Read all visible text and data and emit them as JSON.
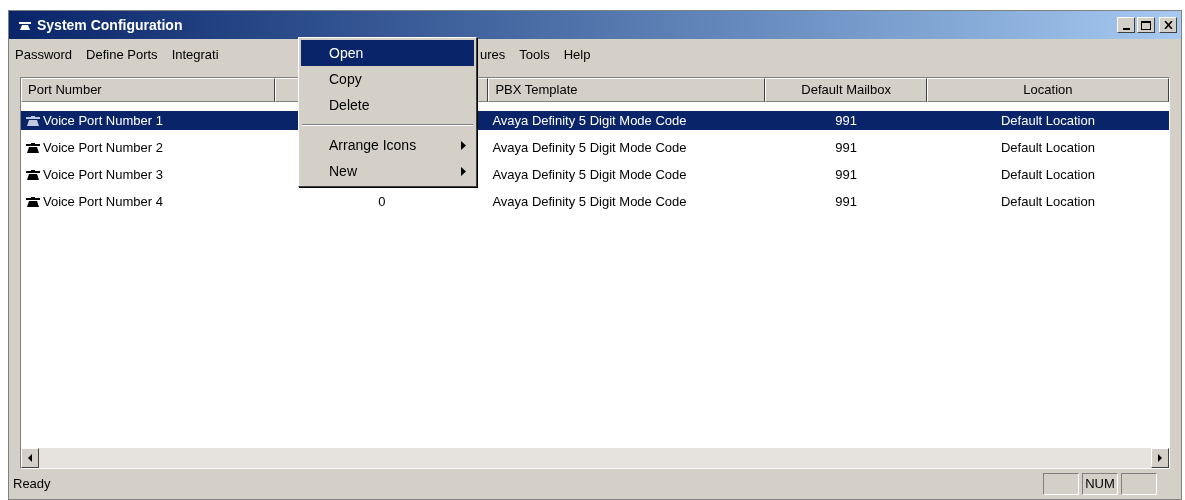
{
  "window": {
    "title": "System Configuration"
  },
  "menu_bar": [
    "Password",
    "Define Ports",
    "Integrati",
    "ures",
    "Tools",
    "Help"
  ],
  "table": {
    "columns": [
      "Port Number",
      "",
      "PBX Template",
      "Default Mailbox",
      "Location"
    ],
    "rows": [
      {
        "selected": true,
        "cells": [
          "Voice Port Number 1",
          "",
          "Avaya Definity 5 Digit Mode Code",
          "991",
          "Default Location"
        ]
      },
      {
        "selected": false,
        "cells": [
          "Voice Port Number 2",
          "",
          "Avaya Definity 5 Digit Mode Code",
          "991",
          "Default Location"
        ]
      },
      {
        "selected": false,
        "cells": [
          "Voice Port Number 3",
          "",
          "Avaya Definity 5 Digit Mode Code",
          "991",
          "Default Location"
        ]
      },
      {
        "selected": false,
        "cells": [
          "Voice Port Number 4",
          "0",
          "Avaya Definity 5 Digit Mode Code",
          "991",
          "Default Location"
        ]
      }
    ]
  },
  "context_menu": [
    {
      "kind": "item",
      "label": "Open",
      "selected": true
    },
    {
      "kind": "item",
      "label": "Copy",
      "selected": false
    },
    {
      "kind": "item",
      "label": "Delete",
      "selected": false
    },
    {
      "kind": "separator"
    },
    {
      "kind": "submenu",
      "label": "Arrange Icons",
      "selected": false
    },
    {
      "kind": "submenu",
      "label": "New",
      "selected": false
    }
  ],
  "status_bar": {
    "text": "Ready",
    "panels": [
      "NUM"
    ]
  }
}
